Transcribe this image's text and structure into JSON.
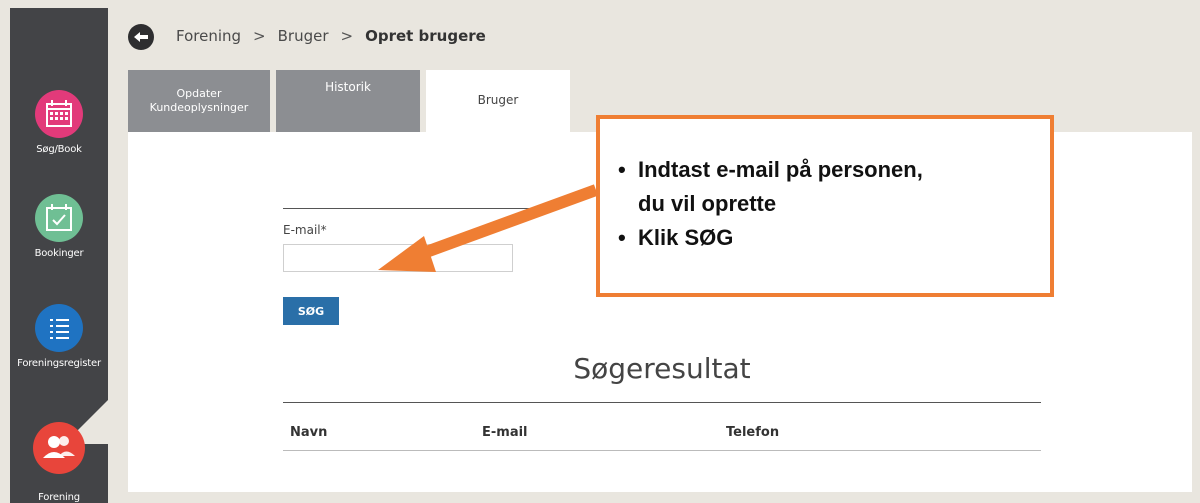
{
  "sidebar": {
    "items": [
      {
        "label": "Søg/Book",
        "icon": "calendar-grid-icon",
        "color": "#e23a7a"
      },
      {
        "label": "Bookinger",
        "icon": "calendar-check-icon",
        "color": "#6fbf94"
      },
      {
        "label": "Foreningsregister",
        "icon": "list-icon",
        "color": "#1f73c2"
      },
      {
        "label": "Forening",
        "icon": "users-icon",
        "color": "#e8453b"
      }
    ]
  },
  "breadcrumb": {
    "items": [
      "Forening",
      "Bruger",
      "Opret brugere"
    ],
    "separator": ">"
  },
  "tabs": [
    {
      "label_line1": "Opdater",
      "label_line2": "Kundeoplysninger"
    },
    {
      "label": "Historik"
    },
    {
      "label": "Bruger"
    }
  ],
  "form": {
    "email_label": "E-mail*",
    "email_value": "",
    "search_button": "SØG"
  },
  "results": {
    "title": "Søgeresultat",
    "columns": [
      "Navn",
      "E-mail",
      "Telefon"
    ]
  },
  "callout": {
    "line1": "Indtast e-mail på personen,",
    "line2": "du vil oprette",
    "line3": "Klik SØG",
    "border_color": "#ef7e33"
  }
}
